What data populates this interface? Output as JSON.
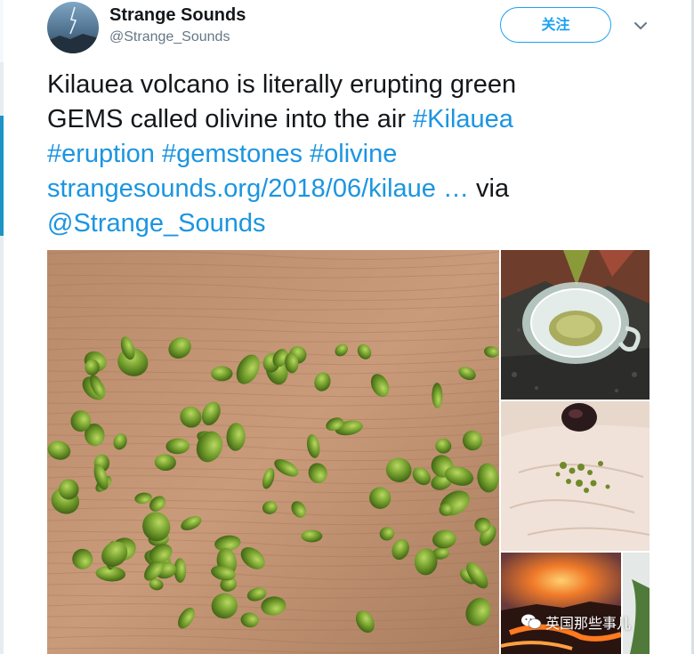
{
  "account": {
    "name": "Strange Sounds",
    "handle": "@Strange_Sounds",
    "avatar_icon": "storm-avatar"
  },
  "actions": {
    "follow_label": "关注",
    "more_icon": "chevron-down-icon"
  },
  "tweet": {
    "line1": "Kilauea volcano is literally erupting green",
    "line2_plain": "GEMS called olivine into the air ",
    "line2_hashtag": "#Kilauea",
    "line3_hashtags": "#eruption #gemstones #olivine",
    "line4_url": "strangesounds.org/2018/06/kilaue",
    "line4_ellipsis": " …",
    "line4_via": " via",
    "line5_mention": "@Strange_Sounds"
  },
  "media": {
    "photos": [
      "olivine-gems-on-wood",
      "olivine-in-glass-dish",
      "olivine-in-palm",
      "lava-eruption"
    ]
  },
  "watermark": {
    "text": "英国那些事儿",
    "icon": "wechat-icon"
  },
  "colors": {
    "link": "#1b95e0",
    "follow_border": "#1da1f2",
    "text": "#14171a",
    "muted": "#657786"
  }
}
